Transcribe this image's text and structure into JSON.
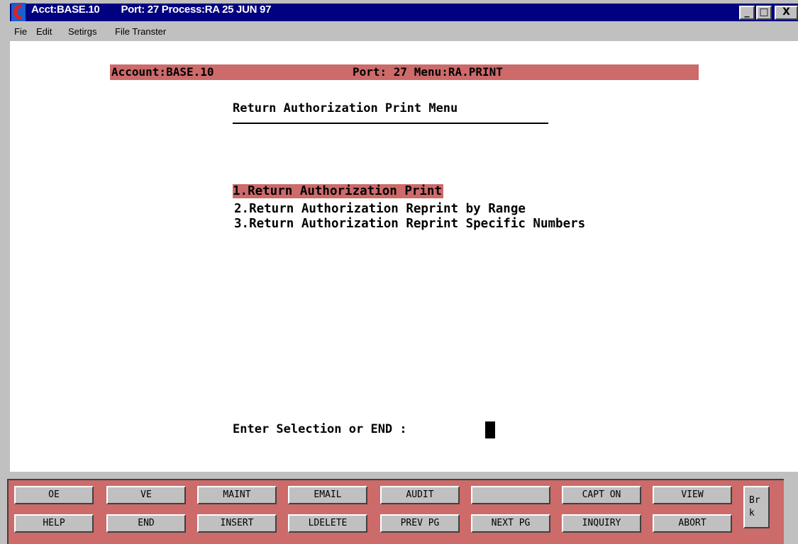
{
  "window": {
    "title_account": "Acct:BASE.10",
    "title_process": "Port: 27 Process:RA 25 JUN 97",
    "minimize_glyph": "_",
    "maximize_glyph": "□",
    "close_glyph": "X"
  },
  "menubar": {
    "items": [
      "Fie",
      "Edit",
      "Setirgs",
      "File Transter"
    ]
  },
  "terminal": {
    "status_account": "Account:BASE.10",
    "status_port": "Port: 27 Menu:RA.PRINT",
    "heading": "Return Authorization Print Menu",
    "options": [
      "1.Return Authorization Print",
      "2.Return Authorization Reprint by Range",
      "3.Return Authorization Reprint Specific Numbers"
    ],
    "selected_option": 1,
    "prompt": "Enter Selection or END :"
  },
  "function_keys": {
    "row1": [
      "OE",
      "VE",
      "MAINT",
      "EMAIL",
      "AUDIT",
      "",
      "CAPT ON",
      "VIEW"
    ],
    "row2": [
      "HELP",
      "END",
      "INSERT",
      "LDELETE",
      "PREV PG",
      "NEXT PG",
      "INQUIRY",
      "ABORT"
    ],
    "break_label": "Br\nk"
  },
  "colors": {
    "title_bar": "#000080",
    "highlight": "#cd6a6a",
    "panel": "#c0c0c0"
  }
}
